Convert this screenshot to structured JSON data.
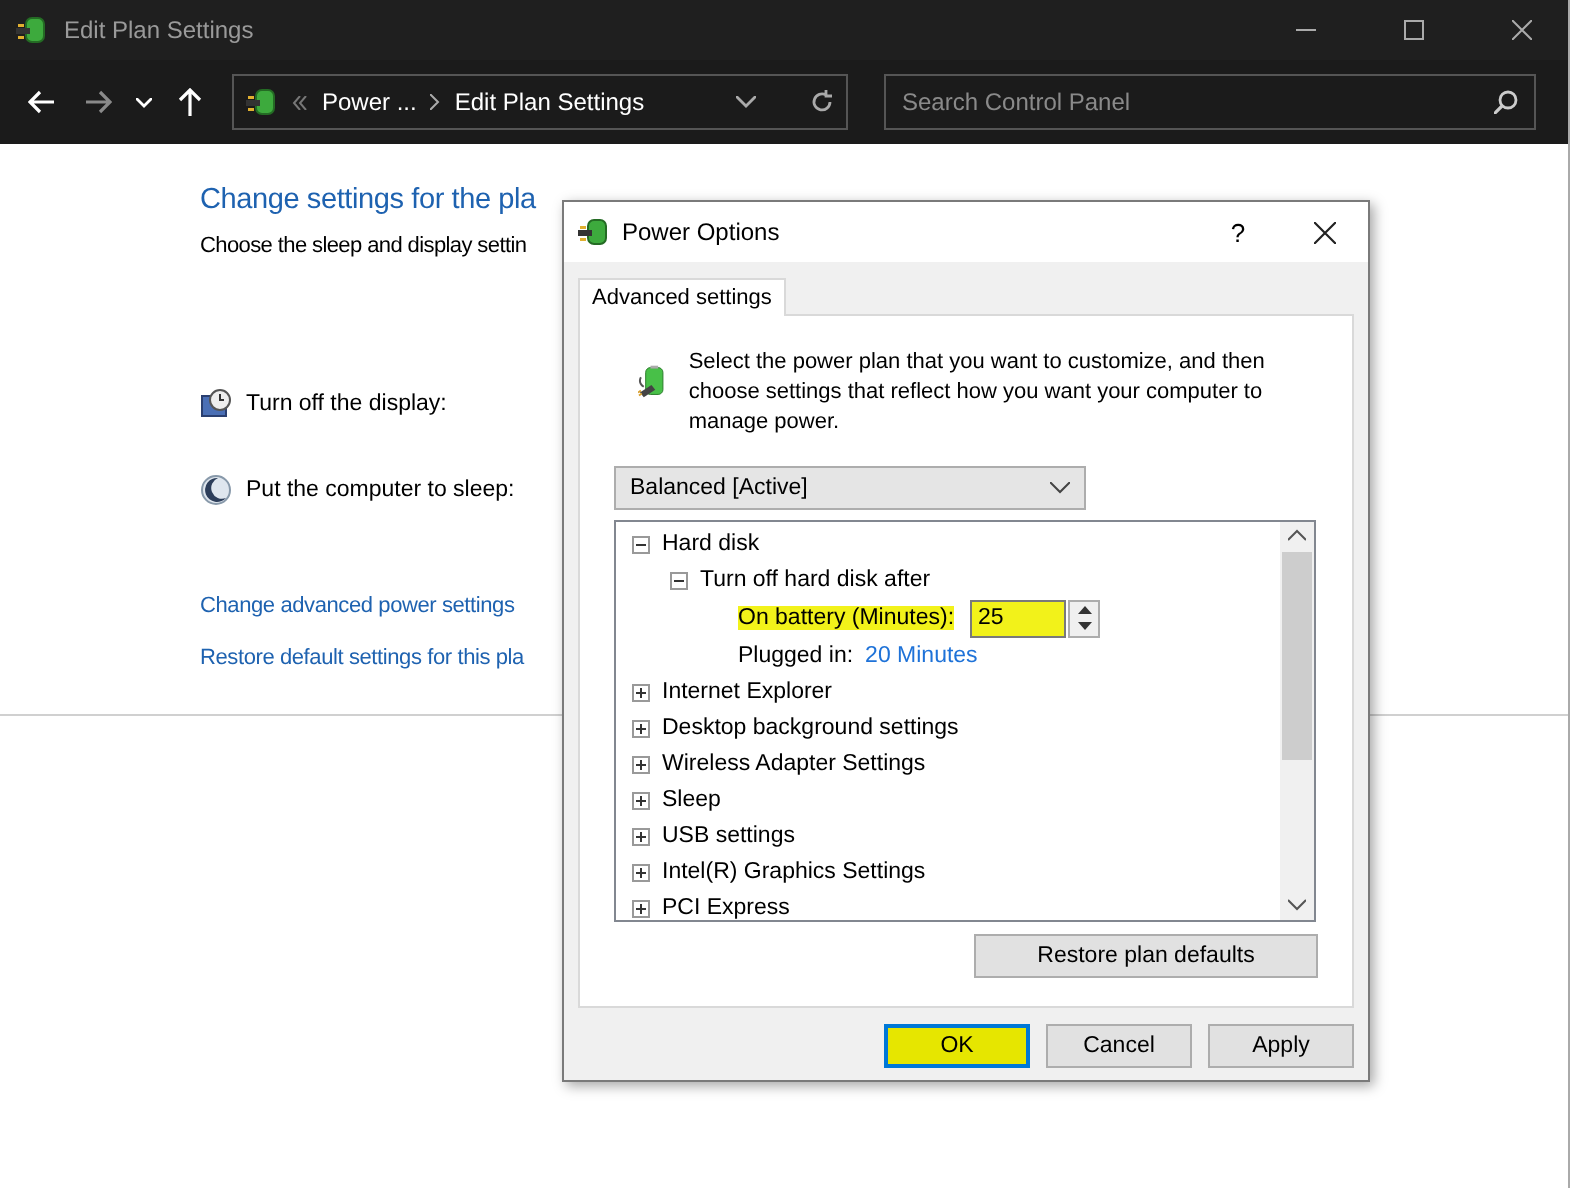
{
  "window": {
    "title": "Edit Plan Settings"
  },
  "address_bar": {
    "breadcrumbs": [
      "Power ...",
      "Edit Plan Settings"
    ]
  },
  "search": {
    "placeholder": "Search Control Panel"
  },
  "page": {
    "heading": "Change settings for the pla",
    "subheading": "Choose the sleep and display settin",
    "settings": [
      {
        "label": "Turn off the display:",
        "kind": "display"
      },
      {
        "label": "Put the computer to sleep:",
        "kind": "sleep"
      }
    ],
    "links": [
      "Change advanced power settings",
      "Restore default settings for this pla"
    ]
  },
  "dialog": {
    "title": "Power Options",
    "help": "?",
    "tabs": [
      {
        "label": "Advanced settings",
        "selected": true
      }
    ],
    "description": "Select the power plan that you want to customize, and then choose settings that reflect how you want your computer to manage power.",
    "plan_select": {
      "value": "Balanced [Active]"
    },
    "tree": [
      {
        "kind": "group",
        "label": "Hard disk",
        "expanded": true,
        "children": [
          {
            "kind": "group",
            "label": "Turn off hard disk after",
            "expanded": true,
            "children": [
              {
                "kind": "spinner",
                "label": "On battery (Minutes):",
                "value": "25",
                "highlighted": true
              },
              {
                "kind": "value",
                "label": "Plugged in:",
                "value": "20 Minutes"
              }
            ]
          }
        ]
      },
      {
        "kind": "group",
        "label": "Internet Explorer",
        "expanded": false
      },
      {
        "kind": "group",
        "label": "Desktop background settings",
        "expanded": false
      },
      {
        "kind": "group",
        "label": "Wireless Adapter Settings",
        "expanded": false
      },
      {
        "kind": "group",
        "label": "Sleep",
        "expanded": false
      },
      {
        "kind": "group",
        "label": "USB settings",
        "expanded": false
      },
      {
        "kind": "group",
        "label": "Intel(R) Graphics Settings",
        "expanded": false
      },
      {
        "kind": "group",
        "label": "PCI Express",
        "expanded": false
      }
    ],
    "restore_button": "Restore plan defaults",
    "buttons": [
      {
        "label": "OK",
        "highlighted": true,
        "focused": true
      },
      {
        "label": "Cancel",
        "highlighted": false,
        "focused": false
      },
      {
        "label": "Apply",
        "highlighted": false,
        "focused": false
      }
    ]
  }
}
